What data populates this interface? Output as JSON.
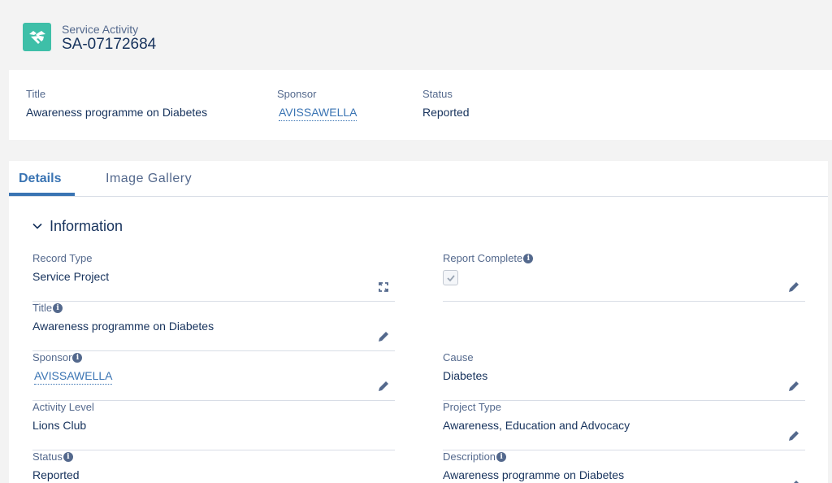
{
  "header": {
    "object_label": "Service Activity",
    "record_name": "SA-07172684",
    "icon": "handshake-icon",
    "icon_color": "#3ebfa8"
  },
  "highlights": {
    "title_label": "Title",
    "title_value": "Awareness programme on Diabetes",
    "sponsor_label": "Sponsor",
    "sponsor_value": "AVISSAWELLA",
    "status_label": "Status",
    "status_value": "Reported"
  },
  "tabs": [
    {
      "label": "Details",
      "active": true
    },
    {
      "label": "Image Gallery",
      "active": false
    }
  ],
  "section": {
    "title": "Information",
    "expanded": true
  },
  "fields": {
    "record_type": {
      "label": "Record Type",
      "value": "Service Project"
    },
    "report_complete": {
      "label": "Report Complete",
      "checked": true
    },
    "title": {
      "label": "Title",
      "value": "Awareness programme on Diabetes"
    },
    "sponsor": {
      "label": "Sponsor",
      "value": "AVISSAWELLA"
    },
    "cause": {
      "label": "Cause",
      "value": "Diabetes"
    },
    "activity_level": {
      "label": "Activity Level",
      "value": "Lions Club"
    },
    "project_type": {
      "label": "Project Type",
      "value": "Awareness, Education and Advocacy"
    },
    "status": {
      "label": "Status",
      "value": "Reported"
    },
    "description": {
      "label": "Description",
      "value": "Awareness programme on Diabetes"
    }
  },
  "colors": {
    "link": "#3a74b3",
    "text": "#16325c",
    "label": "#54698d",
    "active_tab": "#3a74b3"
  }
}
